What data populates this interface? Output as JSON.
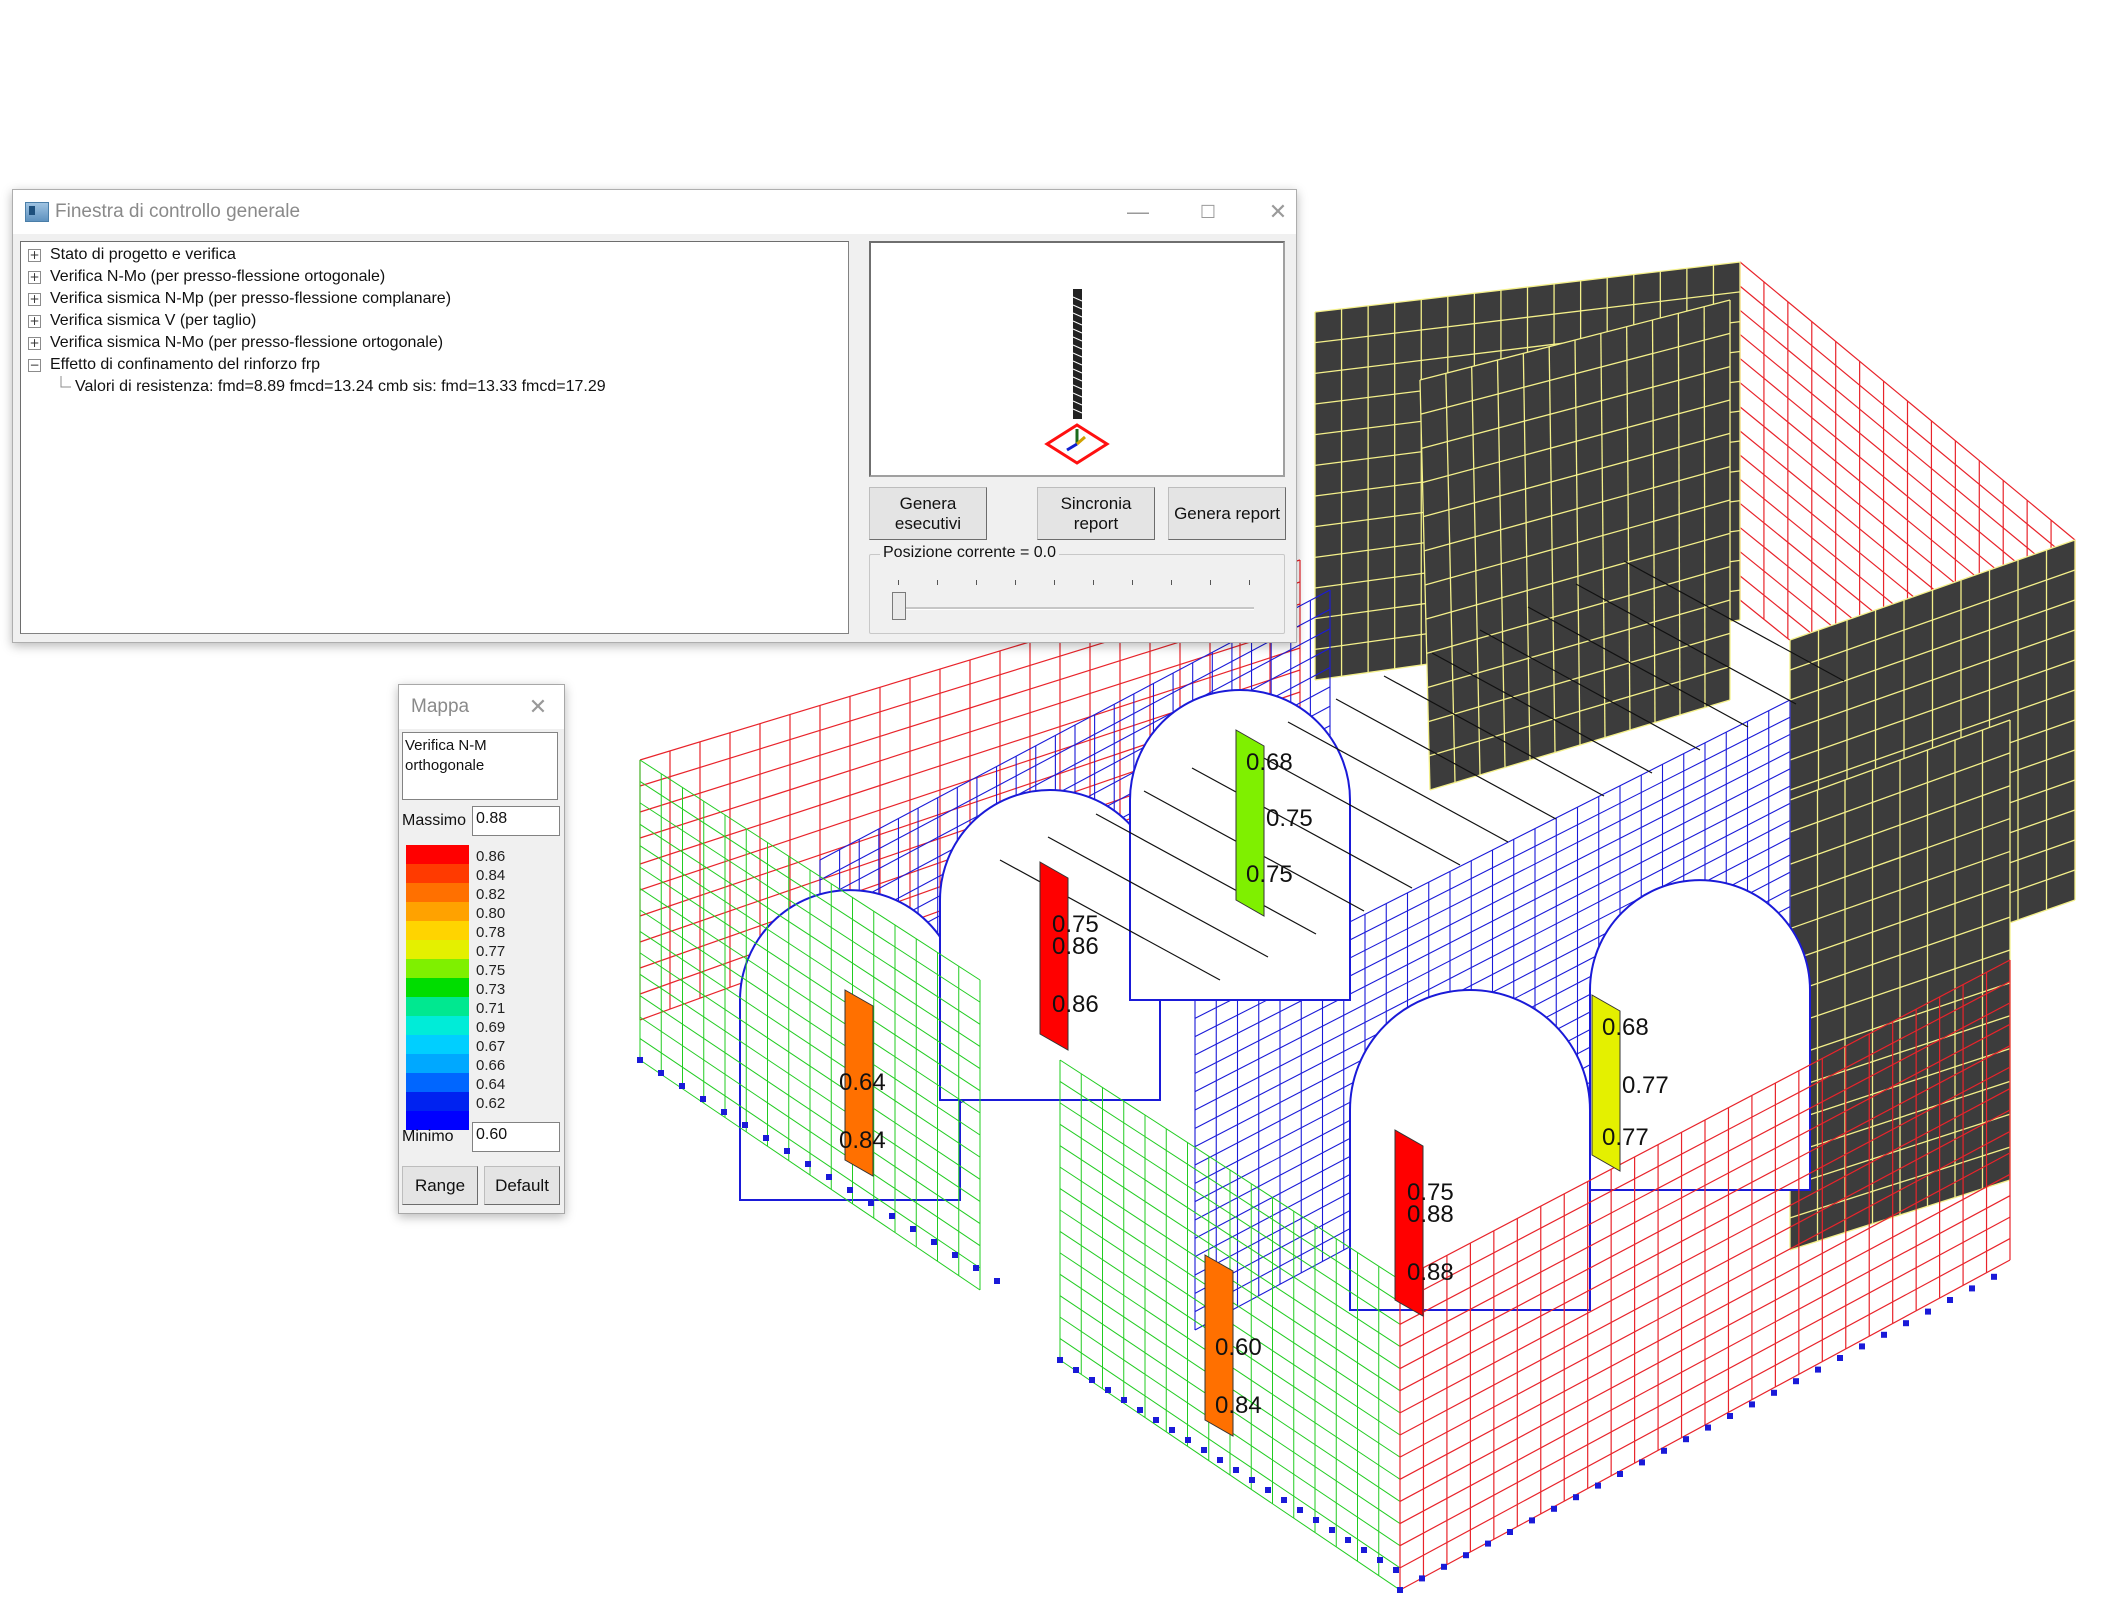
{
  "control_window": {
    "title": "Finestra di controllo generale",
    "buttons": {
      "minimize": "—",
      "maximize": "☐",
      "close": "✕"
    },
    "tree": [
      {
        "label": "Stato di progetto e verifica",
        "expander": "+"
      },
      {
        "label": "Verifica N-Mo (per presso-flessione ortogonale)",
        "expander": "+"
      },
      {
        "label": "Verifica sismica N-Mp (per presso-flessione complanare)",
        "expander": "+"
      },
      {
        "label": "Verifica sismica V (per taglio)",
        "expander": "+"
      },
      {
        "label": "Verifica sismica N-Mo (per presso-flessione ortogonale)",
        "expander": "+"
      },
      {
        "label": "Effetto di confinamento del rinforzo frp",
        "expander": "−"
      }
    ],
    "tree_child": "Valori di resistenza: fmd=8.89 fmcd=13.24  cmb sis: fmd=13.33 fmcd=17.29",
    "actions": {
      "genera_esecutivi": "Genera\nesecutivi",
      "sincronia_report": "Sincronia\nreport",
      "genera_report": "Genera report"
    },
    "position": {
      "label": "Posizione corrente = 0.0",
      "value": 0.0
    }
  },
  "map_window": {
    "title": "Mappa",
    "close": "✕",
    "description": "Verifica N-M\northogonale",
    "max_label": "Massimo",
    "max_value": "0.88",
    "min_label": "Minimo",
    "min_value": "0.60",
    "range_button": "Range",
    "default_button": "Default",
    "legend": [
      {
        "value": "0.86",
        "color": "#ff0000"
      },
      {
        "value": "0.84",
        "color": "#ff3a00"
      },
      {
        "value": "0.82",
        "color": "#ff7000"
      },
      {
        "value": "0.80",
        "color": "#ffa200"
      },
      {
        "value": "0.78",
        "color": "#ffd400"
      },
      {
        "value": "0.77",
        "color": "#e4f000"
      },
      {
        "value": "0.75",
        "color": "#7ff000"
      },
      {
        "value": "0.73",
        "color": "#00dd00"
      },
      {
        "value": "0.71",
        "color": "#00e890"
      },
      {
        "value": "0.69",
        "color": "#00ecd8"
      },
      {
        "value": "0.67",
        "color": "#00cfff"
      },
      {
        "value": "0.66",
        "color": "#00a8ff"
      },
      {
        "value": "0.64",
        "color": "#0066ff"
      },
      {
        "value": "0.62",
        "color": "#0022f0"
      },
      {
        "value": "",
        "color": "#0000ff"
      }
    ]
  },
  "model": {
    "line_colors": {
      "red_wall": "#e8242b",
      "blue_mesh": "#1a1ad8",
      "green_mesh": "#22cc22",
      "yellow_mesh": "#f4f08a",
      "dark_panel": "#3c3c3c"
    },
    "piers": [
      {
        "color": "#ff7000",
        "labels": [
          "0.64",
          "0.84"
        ]
      },
      {
        "color": "#ff0000",
        "labels": [
          "0.75",
          "0.86",
          "0.86"
        ]
      },
      {
        "color": "#7ff000",
        "labels": [
          "0.68",
          "0.75",
          "0.75"
        ]
      },
      {
        "color": "#ff7000",
        "labels": [
          "0.60",
          "0.84"
        ]
      },
      {
        "color": "#ff0000",
        "labels": [
          "0.75",
          "0.88",
          "0.88"
        ]
      },
      {
        "color": "#e4f000",
        "labels": [
          "0.68",
          "0.77",
          "0.77"
        ]
      }
    ]
  }
}
